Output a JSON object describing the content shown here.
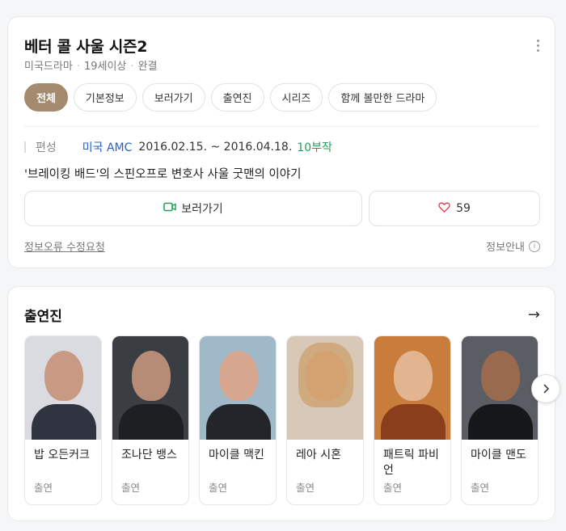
{
  "header": {
    "title": "베터 콜 사울 시즌2",
    "meta": [
      "미국드라마",
      "19세이상",
      "완결"
    ]
  },
  "tabs": [
    {
      "label": "전체",
      "active": true
    },
    {
      "label": "기본정보",
      "active": false
    },
    {
      "label": "보러가기",
      "active": false
    },
    {
      "label": "출연진",
      "active": false
    },
    {
      "label": "시리즈",
      "active": false
    },
    {
      "label": "함께 볼만한 드라마",
      "active": false
    }
  ],
  "info": {
    "label": "편성",
    "channel": "미국 AMC",
    "dates": "2016.02.15. ~ 2016.04.18.",
    "episodes": "10부작",
    "description": "'브레이킹 배드'의 스핀오프로 변호사 사울 굿맨의 이야기"
  },
  "actions": {
    "watch_label": "보러가기",
    "like_count": "59"
  },
  "footer": {
    "report_label": "정보오류 수정요청",
    "guide_label": "정보안내"
  },
  "cast": {
    "title": "출연진",
    "members": [
      {
        "name": "밥 오든커크",
        "role": "출연"
      },
      {
        "name": "조나단 뱅스",
        "role": "출연"
      },
      {
        "name": "마이클 맥킨",
        "role": "출연"
      },
      {
        "name": "레아 시혼",
        "role": "출연"
      },
      {
        "name": "패트릭 파비언",
        "role": "출연"
      },
      {
        "name": "마이클 맨도",
        "role": "출연"
      }
    ]
  },
  "colors": {
    "active_tab": "#a48a6e",
    "channel_link": "#2b5fc7",
    "episodes": "#22a05a",
    "heart": "#e0455c",
    "watch_icon": "#22a05a"
  },
  "icons": {
    "more": "more-vertical-icon",
    "watch": "video-icon",
    "like": "heart-icon",
    "info": "info-icon",
    "arrow": "arrow-right-icon",
    "next": "chevron-right-icon"
  }
}
